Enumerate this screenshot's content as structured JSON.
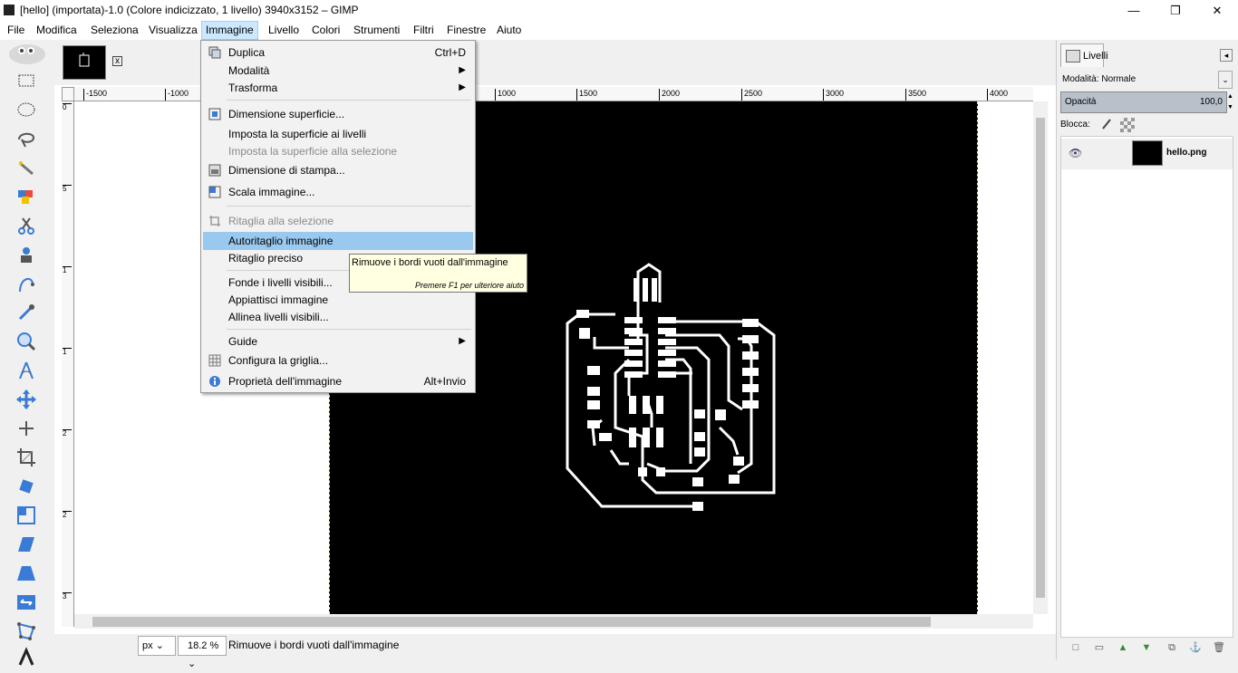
{
  "window": {
    "title": "[hello] (importata)-1.0 (Colore indicizzato, 1 livello) 3940x3152 – GIMP",
    "minimize": "—",
    "maximize": "❐",
    "close": "✕"
  },
  "menubar": [
    "File",
    "Modifica",
    "Seleziona",
    "Visualizza",
    "Immagine",
    "Livello",
    "Colori",
    "Strumenti",
    "Filtri",
    "Finestre",
    "Aiuto"
  ],
  "image_tab": {
    "close": "x"
  },
  "ruler": {
    "h_ticks": [
      "-1500",
      "-1000",
      "1000",
      "1500",
      "2000",
      "2500",
      "3000",
      "3500",
      "4000"
    ],
    "v_ticks": [
      "0",
      "5",
      "1",
      "1",
      "2",
      "2",
      "3"
    ]
  },
  "image_menu": {
    "items": [
      {
        "label": "Duplica",
        "shortcut": "Ctrl+D",
        "icon": "duplicate-icon"
      },
      {
        "label": "Modalità",
        "submenu": true
      },
      {
        "label": "Trasforma",
        "submenu": true
      },
      {
        "label": "Dimensione superficie...",
        "icon": "canvas-size-icon"
      },
      {
        "label": "Imposta la superficie ai livelli"
      },
      {
        "label": "Imposta la superficie alla selezione",
        "disabled": true
      },
      {
        "label": "Dimensione di stampa...",
        "icon": "print-size-icon"
      },
      {
        "label": "Scala immagine...",
        "icon": "scale-icon"
      },
      {
        "label": "Ritaglia alla selezione",
        "disabled": true,
        "icon": "crop-icon"
      },
      {
        "label": "Autoritaglio immagine",
        "highlighted": true
      },
      {
        "label": "Ritaglio preciso"
      },
      {
        "label": "Fonde i livelli visibili..."
      },
      {
        "label": "Appiattisci immagine"
      },
      {
        "label": "Allinea livelli visibili..."
      },
      {
        "label": "Guide",
        "submenu": true
      },
      {
        "label": "Configura la griglia...",
        "icon": "grid-icon"
      },
      {
        "label": "Proprietà dell'immagine",
        "shortcut": "Alt+Invio",
        "icon": "info-icon"
      }
    ]
  },
  "tooltip": {
    "text": "Rimuove i bordi vuoti dall'immagine",
    "help": "Premere F1 per ulteriore aiuto"
  },
  "statusbar": {
    "unit": "px",
    "zoom": "18.2 %",
    "message": "Rimuove i bordi vuoti dall'immagine"
  },
  "layers_panel": {
    "tab_label": "Livelli",
    "mode": "Modalità: Normale",
    "opacity_label": "Opacità",
    "opacity_value": "100,0",
    "lock_label": "Blocca:",
    "layer_name": "hello.png"
  }
}
